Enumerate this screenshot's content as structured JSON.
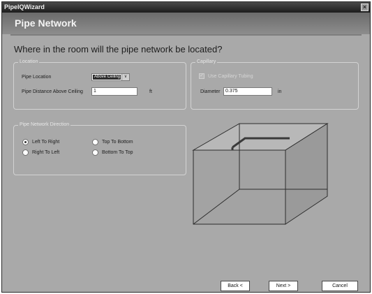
{
  "window": {
    "title": "PipeIQWizard",
    "close_glyph": "×"
  },
  "header": {
    "title": "Pipe Network"
  },
  "question": "Where in the room will the pipe network be located?",
  "location_group": {
    "legend": "Location",
    "pipe_location_label": "Pipe Location",
    "pipe_location_value": "Above Ceiling",
    "dropdown_arrow": "∨",
    "distance_label": "Pipe Distance Above Ceiling",
    "distance_value": "1",
    "distance_unit": "ft"
  },
  "capillary_group": {
    "legend": "Capillary",
    "use_capillary_label": "Use Capillary Tubing",
    "use_capillary_checked": true,
    "check_glyph": "✓",
    "diameter_label": "Diameter",
    "diameter_value": "0.375",
    "diameter_unit": "in"
  },
  "direction_group": {
    "legend": "Pipe Network Direction",
    "options": [
      {
        "label": "Left To Right",
        "checked": true
      },
      {
        "label": "Right To Left",
        "checked": false
      },
      {
        "label": "Top To Bottom",
        "checked": false
      },
      {
        "label": "Bottom To Top",
        "checked": false
      }
    ]
  },
  "buttons": {
    "back": "Back <",
    "next": "Next >",
    "cancel": "Cancel"
  },
  "colors": {
    "background": "#a9a9a9",
    "header": "#7a7a7a",
    "pipe": "#3a3a3a"
  }
}
